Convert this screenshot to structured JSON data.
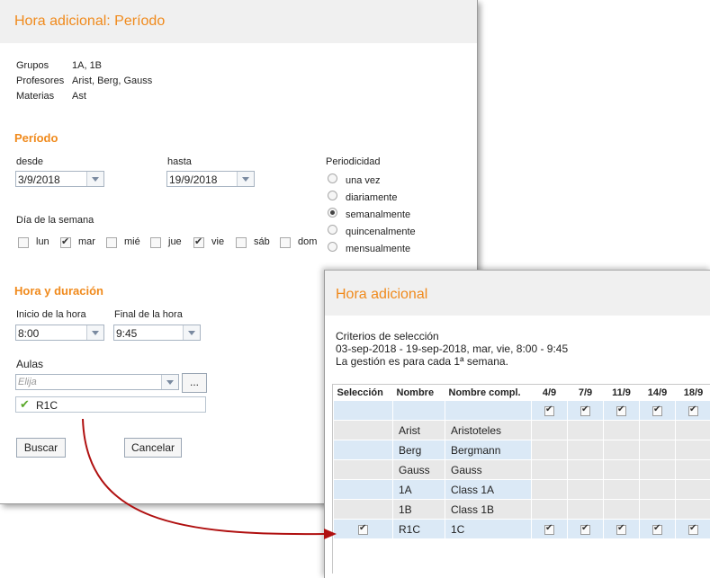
{
  "dialog1": {
    "title": "Hora adicional: Período",
    "info": [
      {
        "label": "Grupos",
        "value": "1A, 1B"
      },
      {
        "label": "Profesores",
        "value": "Arist, Berg, Gauss"
      },
      {
        "label": "Materias",
        "value": "Ast"
      }
    ],
    "periodo": {
      "heading": "Período",
      "desde_label": "desde",
      "desde_value": "3/9/2018",
      "hasta_label": "hasta",
      "hasta_value": "19/9/2018",
      "periodicidad_label": "Periodicidad",
      "options": [
        {
          "label": "una vez",
          "selected": false
        },
        {
          "label": "diariamente",
          "selected": false
        },
        {
          "label": "semanalmente",
          "selected": true
        },
        {
          "label": "quincenalmente",
          "selected": false
        },
        {
          "label": "mensualmente",
          "selected": false
        }
      ],
      "dias_label": "Día de la semana",
      "dias": [
        {
          "label": "lun",
          "checked": false
        },
        {
          "label": "mar",
          "checked": true
        },
        {
          "label": "mié",
          "checked": false
        },
        {
          "label": "jue",
          "checked": false
        },
        {
          "label": "vie",
          "checked": true
        },
        {
          "label": "sáb",
          "checked": false
        },
        {
          "label": "dom",
          "checked": false
        }
      ]
    },
    "hora": {
      "heading": "Hora y duración",
      "inicio_label": "Inicio de la hora",
      "inicio_value": "8:00",
      "final_label": "Final de la hora",
      "final_value": "9:45",
      "aulas_label": "Aulas",
      "aulas_placeholder": "Elija",
      "ellipsis": "...",
      "selected_room": "R1C"
    },
    "buttons": {
      "search": "Buscar",
      "cancel": "Cancelar"
    }
  },
  "dialog2": {
    "title": "Hora adicional",
    "criteria": [
      "Criterios de selección",
      "03-sep-2018 - 19-sep-2018, mar, vie, 8:00 - 9:45",
      "La gestión es para cada 1ª semana."
    ],
    "table": {
      "headers": [
        "Selección",
        "Nombre",
        "Nombre compl.",
        "4/9",
        "7/9",
        "11/9",
        "14/9",
        "18/9"
      ],
      "rows": [
        {
          "sel": false,
          "name": "",
          "full": "",
          "dates": [
            true,
            true,
            true,
            true,
            true
          ],
          "style": "blue"
        },
        {
          "sel": false,
          "name": "Arist",
          "full": "Aristoteles",
          "dates": [
            false,
            false,
            false,
            false,
            false
          ],
          "style": "grey"
        },
        {
          "sel": false,
          "name": "Berg",
          "full": "Bergmann",
          "dates": [
            false,
            false,
            false,
            false,
            false
          ],
          "style": "blue"
        },
        {
          "sel": false,
          "name": "Gauss",
          "full": "Gauss",
          "dates": [
            false,
            false,
            false,
            false,
            false
          ],
          "style": "grey"
        },
        {
          "sel": false,
          "name": "1A",
          "full": "Class 1A",
          "dates": [
            false,
            false,
            false,
            false,
            false
          ],
          "style": "blue"
        },
        {
          "sel": false,
          "name": "1B",
          "full": "Class 1B",
          "dates": [
            false,
            false,
            false,
            false,
            false
          ],
          "style": "grey"
        },
        {
          "sel": true,
          "name": "R1C",
          "full": "1C",
          "dates": [
            true,
            true,
            true,
            true,
            true
          ],
          "style": "blue"
        }
      ]
    }
  },
  "colors": {
    "accent": "#f08a1c",
    "arrow": "#b01010",
    "row_blue": "#dbe9f6",
    "row_grey": "#e8e8e8"
  }
}
